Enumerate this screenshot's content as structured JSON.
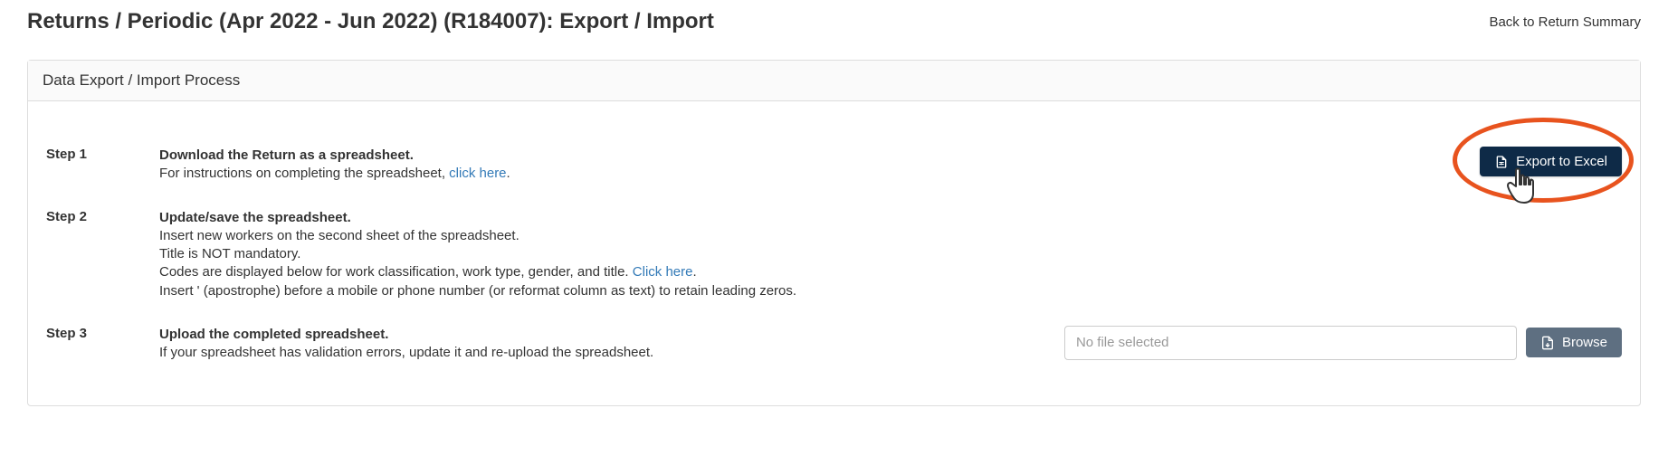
{
  "header": {
    "title": "Returns / Periodic (Apr 2022 - Jun 2022) (R184007): Export / Import",
    "back_link": "Back to Return Summary"
  },
  "panel": {
    "title": "Data Export / Import Process"
  },
  "steps": {
    "step1": {
      "label": "Step 1",
      "bold": "Download the Return as a spreadsheet.",
      "line1_pre": "For instructions on completing the spreadsheet, ",
      "line1_link": "click here",
      "line1_post": "."
    },
    "step2": {
      "label": "Step 2",
      "bold": "Update/save the spreadsheet.",
      "line1": "Insert new workers on the second sheet of the spreadsheet.",
      "line2": "Title is NOT mandatory.",
      "line3_pre": "Codes are displayed below for work classification, work type, gender, and title. ",
      "line3_link": "Click here",
      "line3_post": ".",
      "line4": "Insert ' (apostrophe) before a mobile or phone number (or reformat column as text) to retain leading zeros."
    },
    "step3": {
      "label": "Step 3",
      "bold": "Upload the completed spreadsheet.",
      "line1": "If your spreadsheet has validation errors, update it and re-upload the spreadsheet."
    }
  },
  "buttons": {
    "export": "Export to Excel",
    "browse": "Browse"
  },
  "file_input": {
    "placeholder": "No file selected"
  }
}
